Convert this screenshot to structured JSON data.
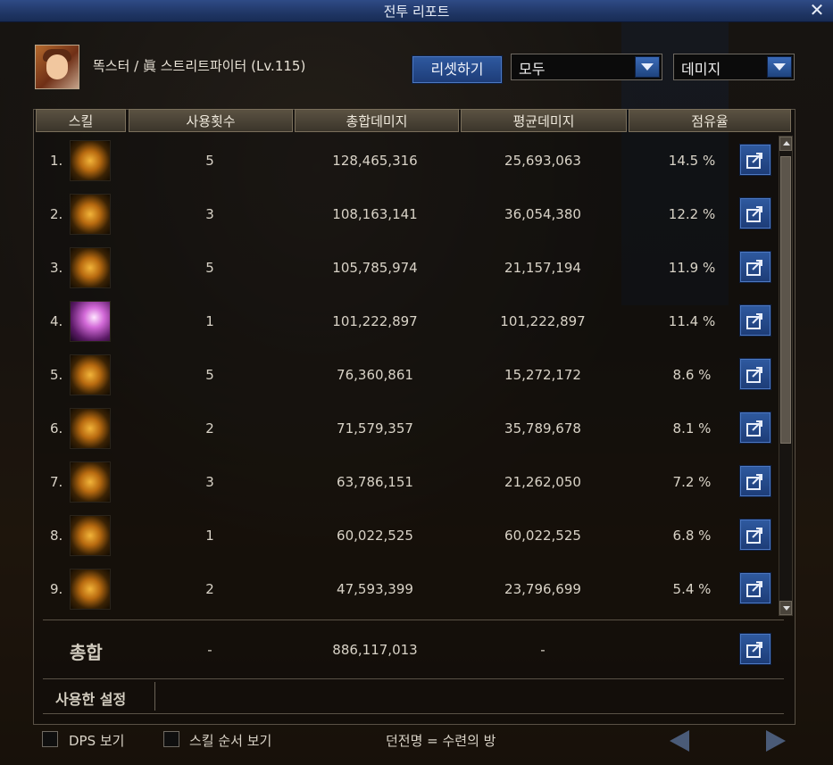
{
  "window": {
    "title": "전투 리포트"
  },
  "character": {
    "name": "똑스터 / 眞 스트리트파이터 (Lv.115)"
  },
  "controls": {
    "reset_label": "리셋하기",
    "filter_select": "모두",
    "type_select": "데미지"
  },
  "table": {
    "headers": {
      "skill": "스킬",
      "uses": "사용횟수",
      "total": "총합데미지",
      "avg": "평균데미지",
      "share": "점유율"
    },
    "rows": [
      {
        "rank": "1.",
        "icon": "skill-icon-bag",
        "uses": "5",
        "total": "128,465,316",
        "avg": "25,693,063",
        "share": "14.5 %"
      },
      {
        "rank": "2.",
        "icon": "skill-icon-bars",
        "uses": "3",
        "total": "108,163,141",
        "avg": "36,054,380",
        "share": "12.2 %"
      },
      {
        "rank": "3.",
        "icon": "skill-icon-barrel",
        "uses": "5",
        "total": "105,785,974",
        "avg": "21,157,194",
        "share": "11.9 %"
      },
      {
        "rank": "4.",
        "icon": "skill-icon-burst",
        "uses": "1",
        "total": "101,222,897",
        "avg": "101,222,897",
        "share": "11.4 %"
      },
      {
        "rank": "5.",
        "icon": "skill-icon-dash",
        "uses": "5",
        "total": "76,360,861",
        "avg": "15,272,172",
        "share": "8.6 %"
      },
      {
        "rank": "6.",
        "icon": "skill-icon-explosion",
        "uses": "2",
        "total": "71,579,357",
        "avg": "35,789,678",
        "share": "8.1 %"
      },
      {
        "rank": "7.",
        "icon": "skill-icon-slash",
        "uses": "3",
        "total": "63,786,151",
        "avg": "21,262,050",
        "share": "7.2 %"
      },
      {
        "rank": "8.",
        "icon": "skill-icon-fire",
        "uses": "1",
        "total": "60,022,525",
        "avg": "60,022,525",
        "share": "6.8 %"
      },
      {
        "rank": "9.",
        "icon": "skill-icon-dragon",
        "uses": "2",
        "total": "47,593,399",
        "avg": "23,796,699",
        "share": "5.4 %"
      }
    ],
    "total_row": {
      "label": "총합",
      "uses": "-",
      "total": "886,117,013",
      "avg": "-"
    }
  },
  "settings": {
    "label": "사용한 설정"
  },
  "footer": {
    "dps_label": "DPS 보기",
    "order_label": "스킬 순서 보기",
    "info_text": "던전명 = 수련의 방"
  },
  "colors": {
    "title_bar": "#213868",
    "button_blue": "#2f5aa0",
    "header_bg": "#4a4236"
  }
}
